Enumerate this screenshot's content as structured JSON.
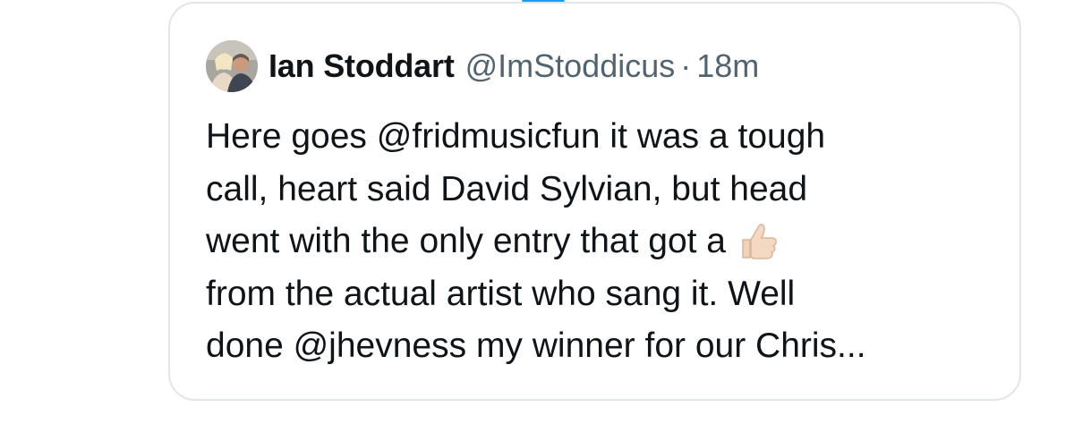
{
  "accent_color": "#1d9bf0",
  "quote": {
    "author": {
      "display_name": "Ian Stoddart",
      "handle": "@ImStoddicus",
      "separator": "·",
      "timestamp": "18m",
      "avatar_icon": "profile-photo-avatar"
    },
    "text_lines": [
      "Here goes @fridmusicfun it was a tough",
      "call, heart said David Sylvian, but head",
      "went with the only entry that got a",
      "from the actual artist who sang it. Well",
      "done @jhevness my winner for our Chris..."
    ],
    "inline_emoji": "thumbs-up-emoji"
  }
}
